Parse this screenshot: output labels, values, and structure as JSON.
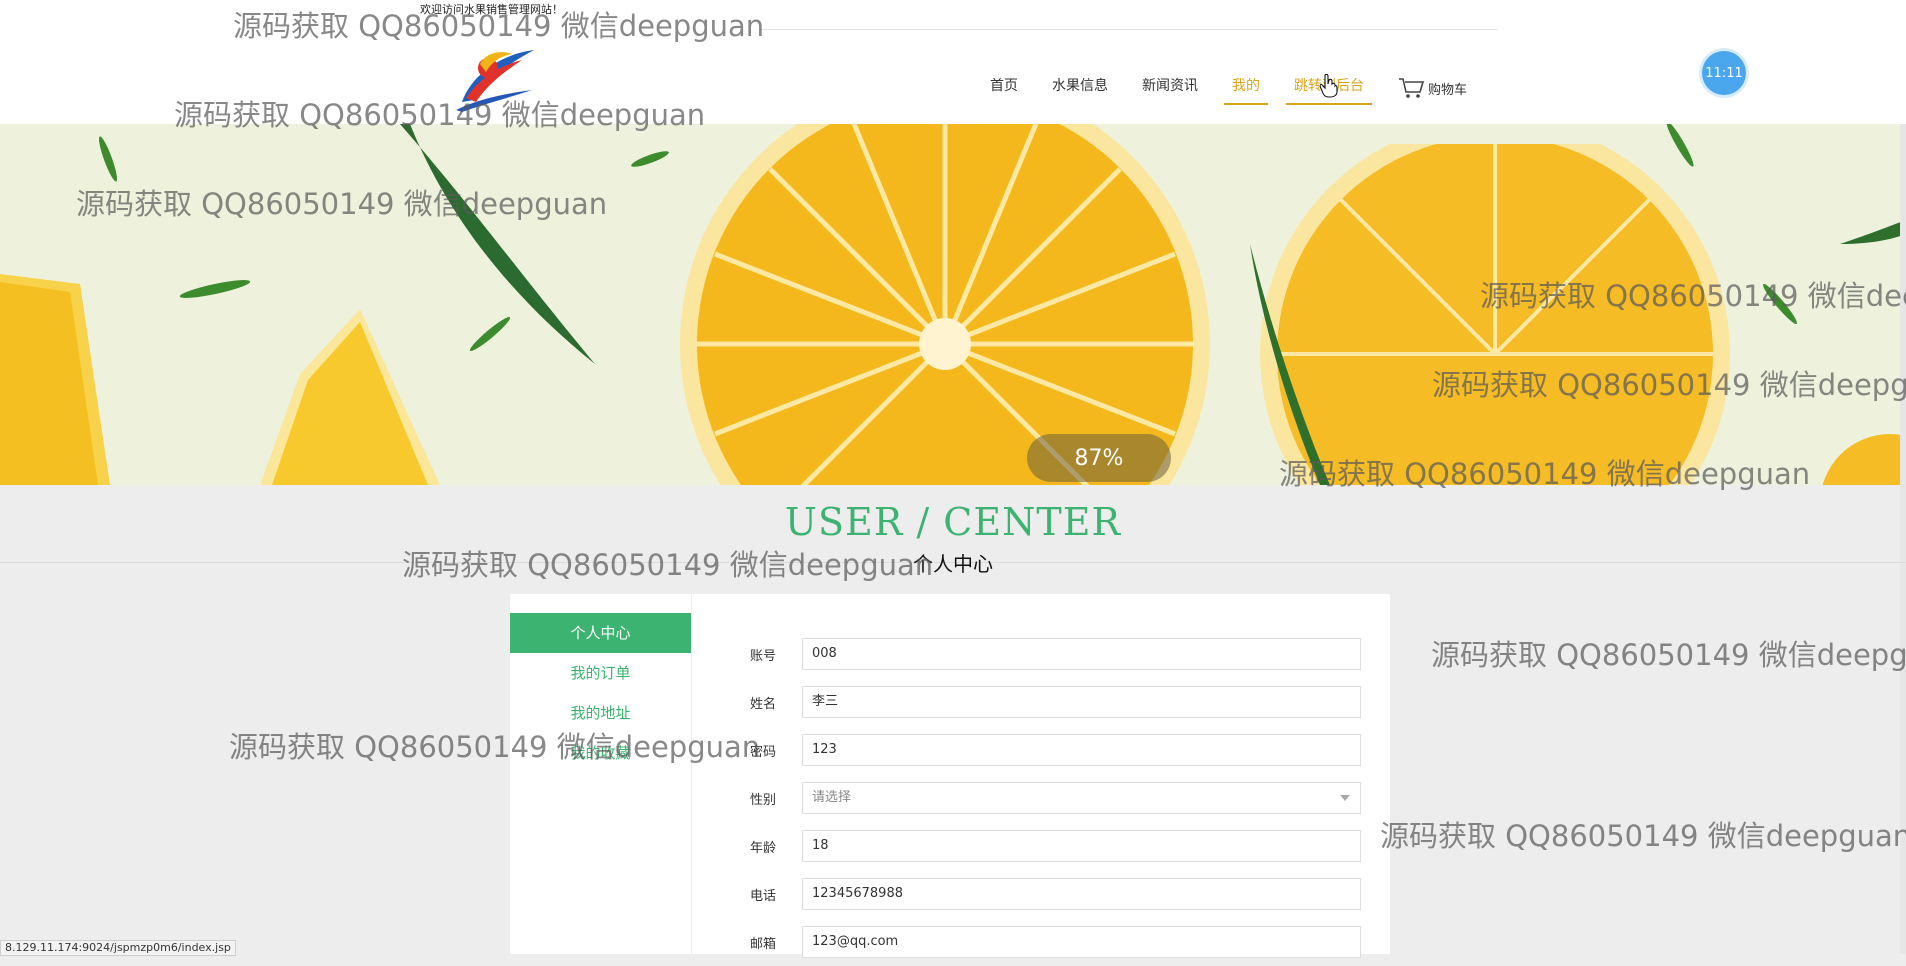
{
  "header": {
    "welcome_text": "欢迎访问水果销售管理网站！",
    "nav": [
      {
        "label": "首页",
        "active": false
      },
      {
        "label": "水果信息",
        "active": false
      },
      {
        "label": "新闻资讯",
        "active": false
      },
      {
        "label": "我的",
        "active": true
      },
      {
        "label": "跳转到后台",
        "active": true
      }
    ],
    "cart_label": "购物车",
    "clock": "11:11"
  },
  "banner": {
    "progress_label": "87%",
    "progress_value": 0.87
  },
  "user_center": {
    "title": "USER / CENTER",
    "subtitle": "个人中心"
  },
  "sidebar": {
    "items": [
      {
        "label": "个人中心",
        "active": true
      },
      {
        "label": "我的订单",
        "active": false
      },
      {
        "label": "我的地址",
        "active": false
      },
      {
        "label": "我的收藏",
        "active": false
      }
    ]
  },
  "form": {
    "account": {
      "label": "账号",
      "value": "008"
    },
    "name": {
      "label": "姓名",
      "value": "李三"
    },
    "password": {
      "label": "密码",
      "value": "123"
    },
    "gender": {
      "label": "性别",
      "placeholder": "请选择"
    },
    "age": {
      "label": "年龄",
      "value": "18"
    },
    "phone": {
      "label": "电话",
      "value": "12345678988"
    },
    "email": {
      "label": "邮箱",
      "value": "123@qq.com"
    }
  },
  "status_url": "8.129.11.174:9024/jspmzp0m6/index.jsp",
  "watermark_text": "源码获取 QQ86050149 微信deepguan",
  "colors": {
    "accent_green": "#3cb371",
    "nav_active": "#d8a51a",
    "clock_blue": "#4aa7ee"
  }
}
